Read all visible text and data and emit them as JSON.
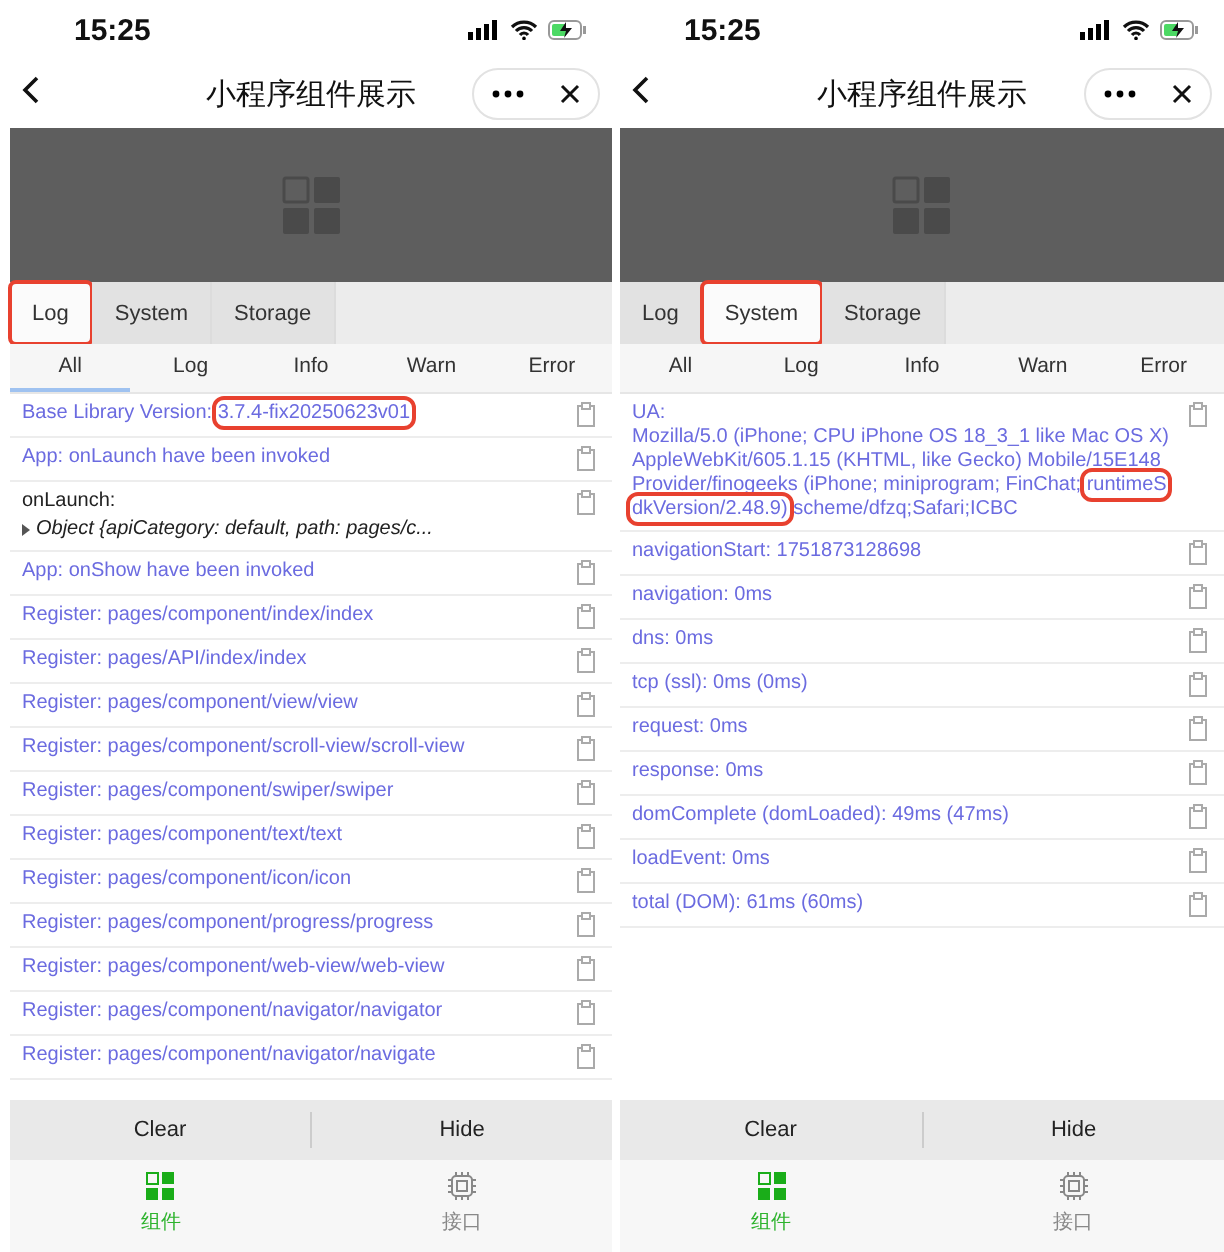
{
  "panels": [
    {
      "status_bar": {
        "time": "15:25"
      },
      "nav": {
        "title": "小程序组件展示"
      },
      "tabs": [
        {
          "label": "Log",
          "selected": true,
          "highlighted": true
        },
        {
          "label": "System",
          "selected": false,
          "highlighted": false
        },
        {
          "label": "Storage",
          "selected": false,
          "highlighted": false
        }
      ],
      "filters": [
        {
          "label": "All",
          "selected": true
        },
        {
          "label": "Log",
          "selected": false
        },
        {
          "label": "Info",
          "selected": false
        },
        {
          "label": "Warn",
          "selected": false
        },
        {
          "label": "Error",
          "selected": false
        }
      ],
      "entries": [
        {
          "kind": "info",
          "parts": [
            {
              "text": "Base Library Version: ",
              "boxed": false
            },
            {
              "text": "3.7.4-fix20250623v01",
              "boxed": true
            }
          ]
        },
        {
          "kind": "info",
          "parts": [
            {
              "text": "App: onLaunch have been invoked",
              "boxed": false
            }
          ]
        },
        {
          "kind": "log",
          "parts": [
            {
              "text": "onLaunch:",
              "boxed": false
            }
          ],
          "detail": "Object {apiCategory: default, path: pages/c..."
        },
        {
          "kind": "info",
          "parts": [
            {
              "text": "App: onShow have been invoked",
              "boxed": false
            }
          ]
        },
        {
          "kind": "info",
          "parts": [
            {
              "text": "Register: pages/component/index/index",
              "boxed": false
            }
          ]
        },
        {
          "kind": "info",
          "parts": [
            {
              "text": "Register: pages/API/index/index",
              "boxed": false
            }
          ]
        },
        {
          "kind": "info",
          "parts": [
            {
              "text": "Register: pages/component/view/view",
              "boxed": false
            }
          ]
        },
        {
          "kind": "info",
          "parts": [
            {
              "text": "Register: pages/component/scroll-view/scroll-view",
              "boxed": false
            }
          ]
        },
        {
          "kind": "info",
          "parts": [
            {
              "text": "Register: pages/component/swiper/swiper",
              "boxed": false
            }
          ]
        },
        {
          "kind": "info",
          "parts": [
            {
              "text": "Register: pages/component/text/text",
              "boxed": false
            }
          ]
        },
        {
          "kind": "info",
          "parts": [
            {
              "text": "Register: pages/component/icon/icon",
              "boxed": false
            }
          ]
        },
        {
          "kind": "info",
          "parts": [
            {
              "text": "Register: pages/component/progress/progress",
              "boxed": false
            }
          ]
        },
        {
          "kind": "info",
          "parts": [
            {
              "text": "Register: pages/component/web-view/web-view",
              "boxed": false
            }
          ]
        },
        {
          "kind": "info",
          "parts": [
            {
              "text": "Register: pages/component/navigator/navigator",
              "boxed": false
            }
          ]
        },
        {
          "kind": "info",
          "parts": [
            {
              "text": "Register: pages/component/navigator/navigate",
              "boxed": false
            }
          ]
        }
      ],
      "actions": [
        "Clear",
        "Hide"
      ],
      "tabbar": [
        {
          "label": "组件",
          "selected": true
        },
        {
          "label": "接口",
          "selected": false
        }
      ]
    },
    {
      "status_bar": {
        "time": "15:25"
      },
      "nav": {
        "title": "小程序组件展示"
      },
      "tabs": [
        {
          "label": "Log",
          "selected": false,
          "highlighted": false
        },
        {
          "label": "System",
          "selected": true,
          "highlighted": true
        },
        {
          "label": "Storage",
          "selected": false,
          "highlighted": false
        }
      ],
      "filters": [
        {
          "label": "All",
          "selected": false
        },
        {
          "label": "Log",
          "selected": false
        },
        {
          "label": "Info",
          "selected": false
        },
        {
          "label": "Warn",
          "selected": false
        },
        {
          "label": "Error",
          "selected": false
        }
      ],
      "entries": [
        {
          "kind": "info",
          "parts": [
            {
              "text": "UA:",
              "boxed": false
            }
          ],
          "lines": [
            {
              "text": "Mozilla/5.0 (iPhone; CPU iPhone OS 18_3_1 like Mac OS X) AppleWebKit/605.1.15 (KHTML, like Gecko) Mobile/15E148 Provider/finogeeks (iPhone; miniprogram; FinChat; ",
              "boxed": false
            },
            {
              "text": "runtimeSdkVersion/2.48.9)",
              "boxed": true
            },
            {
              "text": " scheme/dfzq;Safari;ICBC",
              "boxed": false
            }
          ]
        },
        {
          "kind": "info",
          "parts": [
            {
              "text": "navigationStart: 1751873128698",
              "boxed": false
            }
          ]
        },
        {
          "kind": "info",
          "parts": [
            {
              "text": "navigation: 0ms",
              "boxed": false
            }
          ]
        },
        {
          "kind": "info",
          "parts": [
            {
              "text": "dns: 0ms",
              "boxed": false
            }
          ]
        },
        {
          "kind": "info",
          "parts": [
            {
              "text": "tcp (ssl): 0ms (0ms)",
              "boxed": false
            }
          ]
        },
        {
          "kind": "info",
          "parts": [
            {
              "text": "request: 0ms",
              "boxed": false
            }
          ]
        },
        {
          "kind": "info",
          "parts": [
            {
              "text": "response: 0ms",
              "boxed": false
            }
          ]
        },
        {
          "kind": "info",
          "parts": [
            {
              "text": "domComplete (domLoaded): 49ms (47ms)",
              "boxed": false
            }
          ]
        },
        {
          "kind": "info",
          "parts": [
            {
              "text": "loadEvent: 0ms",
              "boxed": false
            }
          ]
        },
        {
          "kind": "info",
          "parts": [
            {
              "text": "total (DOM): 61ms (60ms)",
              "boxed": false
            }
          ]
        }
      ],
      "actions": [
        "Clear",
        "Hide"
      ],
      "tabbar": [
        {
          "label": "组件",
          "selected": true
        },
        {
          "label": "接口",
          "selected": false
        }
      ]
    }
  ]
}
